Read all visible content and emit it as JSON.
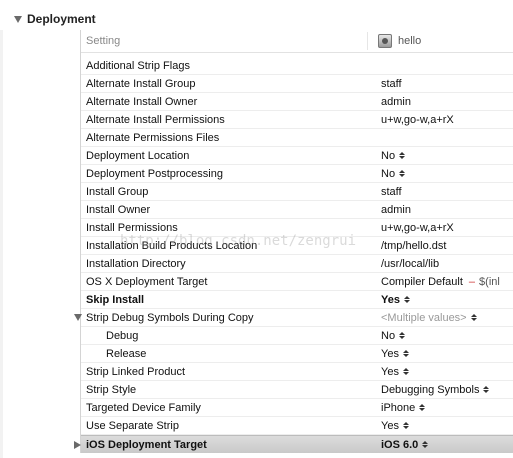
{
  "section": {
    "title": "Deployment"
  },
  "columns": {
    "setting": "Setting",
    "target": "hello"
  },
  "rows": [
    {
      "name": "Additional Strip Flags",
      "value": ""
    },
    {
      "name": "Alternate Install Group",
      "value": "staff"
    },
    {
      "name": "Alternate Install Owner",
      "value": "admin"
    },
    {
      "name": "Alternate Install Permissions",
      "value": "u+w,go-w,a+rX"
    },
    {
      "name": "Alternate Permissions Files",
      "value": ""
    },
    {
      "name": "Deployment Location",
      "value": "No"
    },
    {
      "name": "Deployment Postprocessing",
      "value": "No"
    },
    {
      "name": "Install Group",
      "value": "staff"
    },
    {
      "name": "Install Owner",
      "value": "admin"
    },
    {
      "name": "Install Permissions",
      "value": "u+w,go-w,a+rX"
    },
    {
      "name": "Installation Build Products Location",
      "value": "/tmp/hello.dst"
    },
    {
      "name": "Installation Directory",
      "value": "/usr/local/lib"
    },
    {
      "name": "OS X Deployment Target",
      "value": "Compiler Default",
      "separator": "–",
      "extra": "$(inl"
    },
    {
      "name": "Skip Install",
      "value": "Yes"
    },
    {
      "name": "Strip Debug Symbols During Copy",
      "value": "<Multiple values>"
    },
    {
      "name": "Debug",
      "value": "No"
    },
    {
      "name": "Release",
      "value": "Yes"
    },
    {
      "name": "Strip Linked Product",
      "value": "Yes"
    },
    {
      "name": "Strip Style",
      "value": "Debugging Symbols"
    },
    {
      "name": "Targeted Device Family",
      "value": "iPhone"
    },
    {
      "name": "Use Separate Strip",
      "value": "Yes"
    },
    {
      "name": "iOS Deployment Target",
      "value": "iOS 6.0"
    }
  ],
  "watermark": "http://blog.csdn.net/zengrui",
  "colors": {
    "selected_row": "#d2d2d2",
    "separator_red": "#cc3333",
    "muted_text": "#999999"
  }
}
